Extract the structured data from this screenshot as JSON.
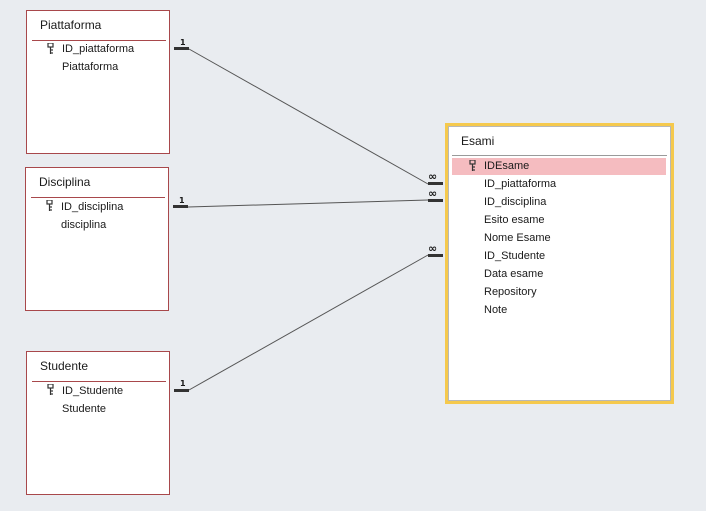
{
  "tables": {
    "piattaforma": {
      "title": "Piattaforma",
      "fields": [
        {
          "name": "ID_piattaforma",
          "key": true
        },
        {
          "name": "Piattaforma",
          "key": false
        }
      ]
    },
    "disciplina": {
      "title": "Disciplina",
      "fields": [
        {
          "name": "ID_disciplina",
          "key": true
        },
        {
          "name": "disciplina",
          "key": false
        }
      ]
    },
    "studente": {
      "title": "Studente",
      "fields": [
        {
          "name": "ID_Studente",
          "key": true
        },
        {
          "name": "Studente",
          "key": false
        }
      ]
    },
    "esami": {
      "title": "Esami",
      "fields": [
        {
          "name": "IDEsame",
          "key": true
        },
        {
          "name": "ID_piattaforma",
          "key": false
        },
        {
          "name": "ID_disciplina",
          "key": false
        },
        {
          "name": "Esito esame",
          "key": false
        },
        {
          "name": "Nome Esame",
          "key": false
        },
        {
          "name": "ID_Studente",
          "key": false
        },
        {
          "name": "Data esame",
          "key": false
        },
        {
          "name": "Repository",
          "key": false
        },
        {
          "name": "Note",
          "key": false
        }
      ]
    }
  },
  "relationships": {
    "one_label": "1",
    "many_label": "∞"
  },
  "colors": {
    "table_border": "#a8484b",
    "selected_border": "#f5c94d",
    "selected_field_bg": "#f5bcc0",
    "background": "#e9ecf0"
  }
}
